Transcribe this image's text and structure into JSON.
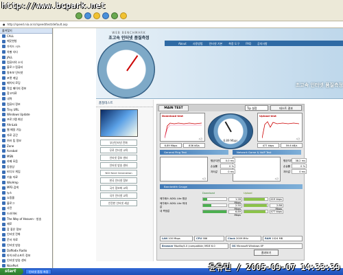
{
  "overlay_url": "http://www.bcpark.net",
  "address": "http://speed.nia.or.kr/speed/test/default.asp",
  "sidebar": {
    "title": "즐겨찾기",
    "items": [
      "CALL",
      "깨끗한방",
      "가이드 시스",
      "차별 다다",
      "JALL",
      "컴퓨터의 소식",
      "블로그 컴퓨터",
      "왕초보 인터넷",
      "포켓 게임",
      "페이지 로딩",
      "작업 페이지 정보",
      "참고자료",
      "내역",
      "컴퓨터 정보",
      "Tiny URL",
      "Windows Update",
      "프로그램 최신",
      "AhnLab",
      "웹 메일 기능",
      "자료 공간",
      "여러 팁 정보",
      "Zone",
      "Acrobat",
      "MSN",
      "카페 모음",
      "동영상",
      "비디오 게임",
      "기술 자료",
      "WinAmp",
      "MP3 검색",
      "뉴스",
      "쇼핑몰",
      "블로그",
      "사전",
      "드라이버",
      "The Way of Heaven - 방송",
      "제로",
      "참 좋은 정보",
      "인터넷 전화",
      "문서 자료",
      "인터넷 방송",
      "Daffodix Radio",
      "마이크로소프트 정보",
      "인터넷 방송 센터",
      "NicePort",
      "Ferry Hotel Interactive Art"
    ]
  },
  "brand": {
    "small": "WEB BENCHMARK",
    "large": "초고속 인터넷 품질측정"
  },
  "nav": [
    "About",
    "사용방법",
    "인터넷 기본",
    "측정 도구",
    "FAQ",
    "공지사항"
  ],
  "hero_text": "초고속 인터넷 품질측정",
  "left_panel": {
    "title": "품질테스트",
    "buttons": [
      "부산인터넷 전화",
      "무료 인터넷 교육",
      "인터넷 정보 센터",
      "인터넷 방송 센터",
      "NGI Next Generation",
      "한국 인터넷 정보",
      "국가 정보화 교육",
      "국가 인터넷 교육",
      "안전한 인터넷 세상"
    ]
  },
  "tabs": {
    "main": "MAIN TEST",
    "tip": "Tip 설정",
    "test_button": "테스트 결과"
  },
  "download": {
    "title": "Download test",
    "speed": "6.89 Mbps",
    "kbps": "836 kB/s",
    "xlabel": "시간"
  },
  "upload": {
    "title": "Upload test",
    "speed": "477 kbps",
    "kbps": "59.6 kB/s",
    "xlabel": "시간"
  },
  "gauge_value": "6.89 Mbps",
  "sections": {
    "general": "General Ping Test",
    "network": "Network Game & VoIP Test",
    "bandwidth": "Bandwidth Gauge"
  },
  "ping_left": {
    "labels": [
      "평균지연율",
      "손실률",
      "지터값"
    ],
    "values": [
      "0.0 ms",
      "0 %",
      "0 ms"
    ]
  },
  "ping_right": {
    "labels": [
      "평균지연율",
      "손실률",
      "지터값"
    ],
    "values": [
      "38.2 ms",
      "0 %",
      "0 ms"
    ]
  },
  "bandwidth": {
    "headers": {
      "download": "Download",
      "upload": "Upload"
    },
    "rows": [
      {
        "label": "메가패스 ADSL Lite 평균",
        "down": "1.28 Mbps",
        "down_pct": 0.19,
        "up": "419 kbps",
        "up_pct": 0.88
      },
      {
        "label": "메가패스 ADSL Lite 최대값",
        "down": "2.50 Mbps",
        "down_pct": 0.36,
        "up": "2.86 Mbps",
        "up_pct": 0.96
      },
      {
        "label": "내 측정값",
        "down": "6.89 Mbps",
        "down_pct": 1.0,
        "up": "477 kbps",
        "up_pct": 0.92
      }
    ]
  },
  "system": {
    "lan": {
      "k": "LAN",
      "v": "100 Mbps"
    },
    "cpu": {
      "k": "CPU",
      "v": "586"
    },
    "clock": {
      "k": "Clock",
      "v": "2009 MHz"
    },
    "ram": {
      "k": "RAM",
      "v": "1024 MB"
    },
    "browser": {
      "k": "Browser",
      "v": "Mozilla/4.0 (compatible; MSIE 6.0"
    },
    "os": {
      "k": "OS",
      "v": "Microsoft Windows XP"
    }
  },
  "result_button": "결과보기",
  "taskbar": {
    "start": "start",
    "task": "인터넷 품질 측정"
  },
  "watermark": "윤유민 / 2005-09-07 14:33:39"
}
